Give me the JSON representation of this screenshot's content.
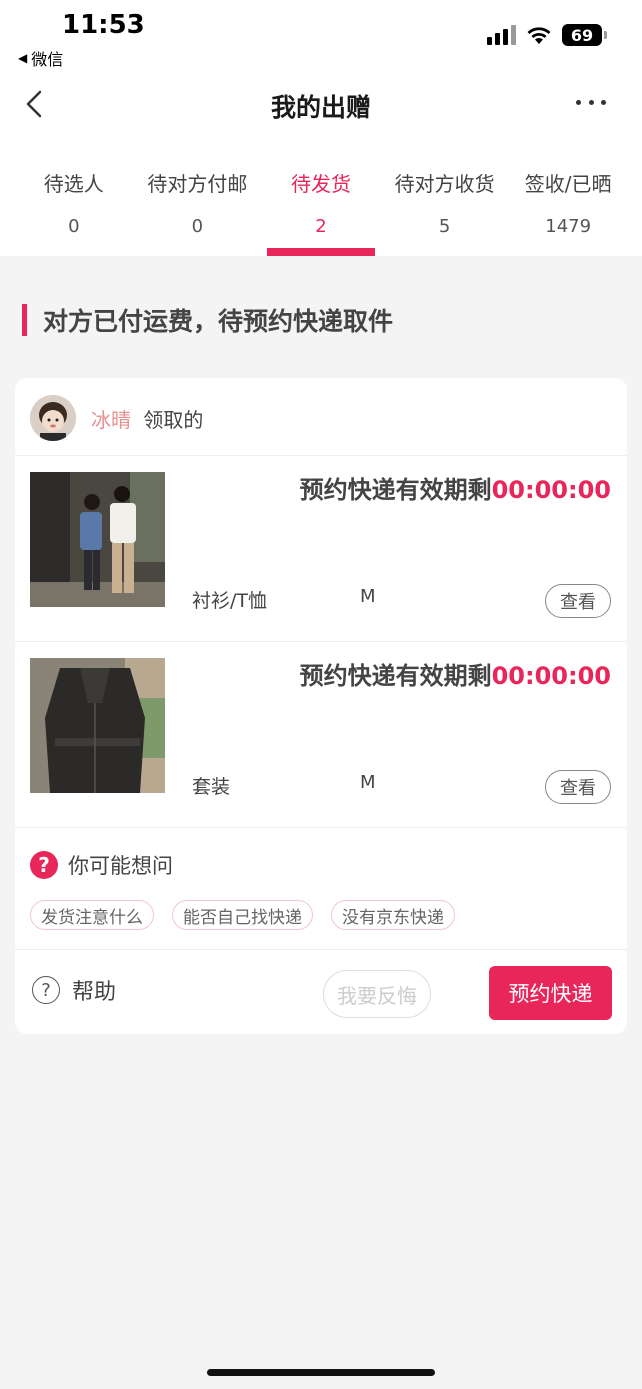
{
  "status_bar": {
    "time": "11:53",
    "back_app": "微信",
    "battery": "69"
  },
  "nav": {
    "title": "我的出赠"
  },
  "tabs": [
    {
      "label": "待选人",
      "count": "0"
    },
    {
      "label": "待对方付邮",
      "count": "0"
    },
    {
      "label": "待发货",
      "count": "2",
      "active": true
    },
    {
      "label": "待对方收货",
      "count": "5"
    },
    {
      "label": "签收/已晒",
      "count": "1479"
    }
  ],
  "section": {
    "heading": "对方已付运费，待预约快递取件"
  },
  "card": {
    "receiver_name": "冰晴",
    "receiver_suffix": "领取的",
    "items": [
      {
        "deadline_label": "预约快递有效期剩",
        "deadline_time": "00:00:00",
        "category": "衬衫/T恤",
        "size": "M",
        "view_label": "查看"
      },
      {
        "deadline_label": "预约快递有效期剩",
        "deadline_time": "00:00:00",
        "category": "套装",
        "size": "M",
        "view_label": "查看"
      }
    ],
    "faq": {
      "title": "你可能想问",
      "chips": [
        "发货注意什么",
        "能否自己找快递",
        "没有京东快递"
      ]
    },
    "actions": {
      "help": "帮助",
      "regret": "我要反悔",
      "book": "预约快递"
    }
  },
  "colors": {
    "accent": "#e8265a",
    "receiver_name": "#e8908e"
  }
}
